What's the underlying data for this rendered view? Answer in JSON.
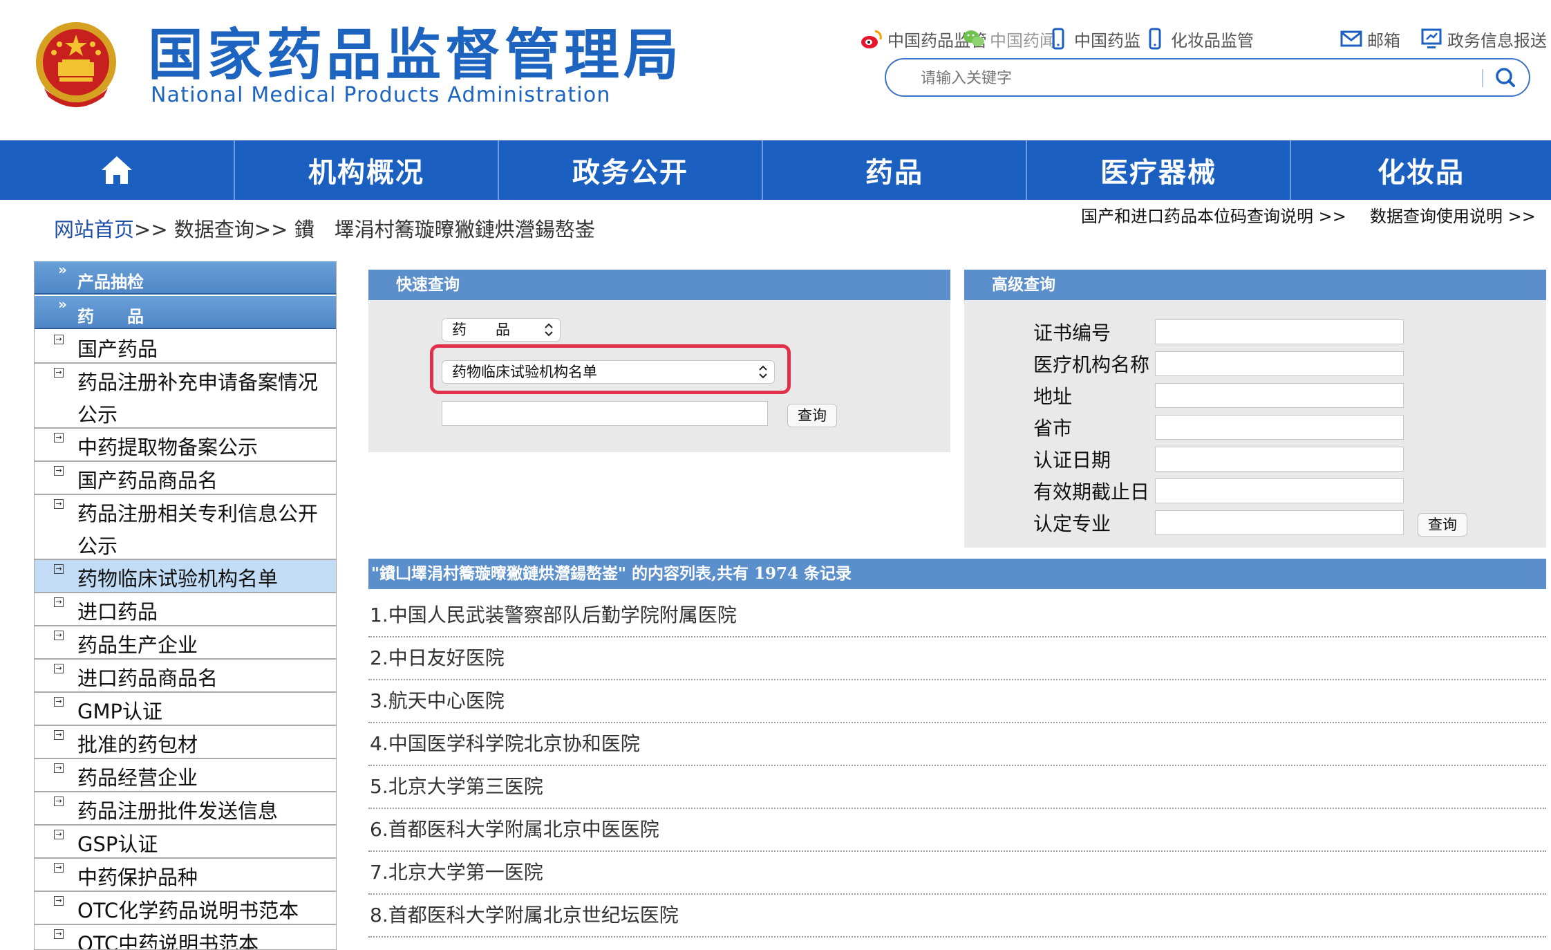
{
  "header": {
    "title_cn": "国家药品监督管理局",
    "title_en": "National Medical Products Administration",
    "top_links": [
      {
        "label": "中国药品监管",
        "icon": "weibo-icon"
      },
      {
        "label": "中国药闻",
        "icon": "wechat-icon"
      },
      {
        "label": "中国药监",
        "icon": "mobile-icon"
      },
      {
        "label": "化妆品监管",
        "icon": "mobile-icon"
      },
      {
        "label": "邮箱",
        "icon": "mail-icon"
      },
      {
        "label": "政务信息报送",
        "icon": "monitor-icon"
      }
    ],
    "search_placeholder": "请输入关键字"
  },
  "nav": {
    "items": [
      "机构概况",
      "政务公开",
      "药品",
      "医疗器械",
      "化妆品"
    ]
  },
  "breadcrumb": {
    "home": "网站首页",
    "sep1": ">>",
    "data_query": "数据查询",
    "sep2": ">>",
    "current": "鐨　墿涓村簥璇曢獙鏈烘瀯鍚嶅崟"
  },
  "help_links": {
    "code_help": "国产和进口药品本位码查询说明 >>",
    "usage_help": "数据查询使用说明 >>"
  },
  "sidebar": {
    "headers": [
      "产品抽检",
      "药　　品"
    ],
    "items": [
      "国产药品",
      "药品注册补充申请备案情况公示",
      "中药提取物备案公示",
      "国产药品商品名",
      "药品注册相关专利信息公开公示",
      "药物临床试验机构名单",
      "进口药品",
      "药品生产企业",
      "进口药品商品名",
      "GMP认证",
      "批准的药包材",
      "药品经营企业",
      "药品注册批件发送信息",
      "GSP认证",
      "中药保护品种",
      "OTC化学药品说明书范本",
      "OTC中药说明书范本"
    ],
    "active_index": 5
  },
  "quick_query": {
    "title": "快速查询",
    "category_select": "药　　品",
    "database_select": "药物临床试验机构名单",
    "keyword_value": "",
    "button": "查询"
  },
  "advanced_query": {
    "title": "高级查询",
    "fields": [
      "证书编号",
      "医疗机构名称",
      "地址",
      "省市",
      "认证日期",
      "有效期截止日",
      "认定专业"
    ],
    "button": "查询"
  },
  "results": {
    "header": "\"鐨凵墿涓村簥璇曢獙鏈烘瀯鍚嶅崟\" 的内容列表,共有 1974 条记录",
    "rows": [
      "1.中国人民武装警察部队后勤学院附属医院",
      "2.中日友好医院",
      "3.航天中心医院",
      "4.中国医学科学院北京协和医院",
      "5.北京大学第三医院",
      "6.首都医科大学附属北京中医医院",
      "7.北京大学第一医院",
      "8.首都医科大学附属北京世纪坛医院"
    ]
  },
  "colors": {
    "brand_blue": "#1b5fc0",
    "panel_blue": "#5b8fcc",
    "highlight_red": "#e2304a",
    "active_row": "#c3dcf5"
  }
}
